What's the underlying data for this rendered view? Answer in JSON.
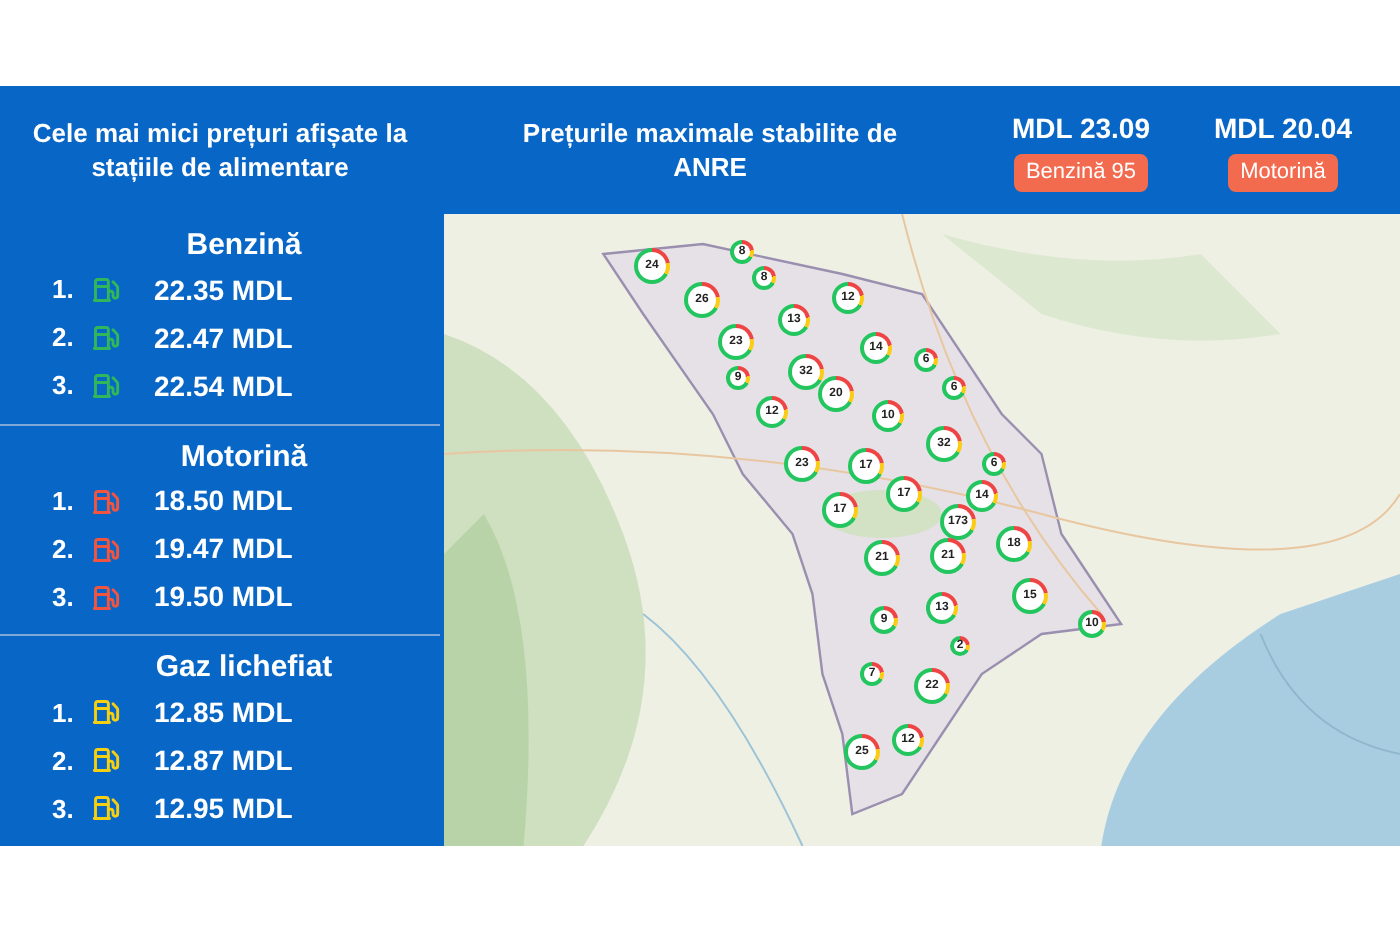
{
  "header": {
    "lowest_prices_title": "Cele mai mici prețuri afișate la stațiile de alimentare",
    "max_prices_title": "Prețurile maximale stabilite de ANRE",
    "max_prices": [
      {
        "price": "MDL 23.09",
        "fuel": "Benzină 95"
      },
      {
        "price": "MDL 20.04",
        "fuel": "Motorină"
      }
    ]
  },
  "fuels": [
    {
      "name": "Benzină",
      "color": "#2fb75a",
      "prices": [
        {
          "rank": "1.",
          "price": "22.35 MDL"
        },
        {
          "rank": "2.",
          "price": "22.47 MDL"
        },
        {
          "rank": "3.",
          "price": "22.54 MDL"
        }
      ]
    },
    {
      "name": "Motorină",
      "color": "#f2553f",
      "prices": [
        {
          "rank": "1.",
          "price": "18.50 MDL"
        },
        {
          "rank": "2.",
          "price": "19.47 MDL"
        },
        {
          "rank": "3.",
          "price": "19.50 MDL"
        }
      ]
    },
    {
      "name": "Gaz lichefiat",
      "color": "#f5cf12",
      "prices": [
        {
          "rank": "1.",
          "price": "12.85 MDL"
        },
        {
          "rank": "2.",
          "price": "12.87 MDL"
        },
        {
          "rank": "3.",
          "price": "12.95 MDL"
        }
      ]
    }
  ],
  "map": {
    "kind": "picture",
    "clusters": [
      {
        "count": "24"
      },
      {
        "count": "8"
      },
      {
        "count": "8"
      },
      {
        "count": "26"
      },
      {
        "count": "12"
      },
      {
        "count": "13"
      },
      {
        "count": "23"
      },
      {
        "count": "14"
      },
      {
        "count": "6"
      },
      {
        "count": "9"
      },
      {
        "count": "32"
      },
      {
        "count": "20"
      },
      {
        "count": "6"
      },
      {
        "count": "12"
      },
      {
        "count": "10"
      },
      {
        "count": "32"
      },
      {
        "count": "23"
      },
      {
        "count": "17"
      },
      {
        "count": "6"
      },
      {
        "count": "17"
      },
      {
        "count": "14"
      },
      {
        "count": "17"
      },
      {
        "count": "173"
      },
      {
        "count": "18"
      },
      {
        "count": "21"
      },
      {
        "count": "21"
      },
      {
        "count": "15"
      },
      {
        "count": "13"
      },
      {
        "count": "9"
      },
      {
        "count": "10"
      },
      {
        "count": "2"
      },
      {
        "count": "7"
      },
      {
        "count": "22"
      },
      {
        "count": "12"
      },
      {
        "count": "25"
      }
    ]
  }
}
